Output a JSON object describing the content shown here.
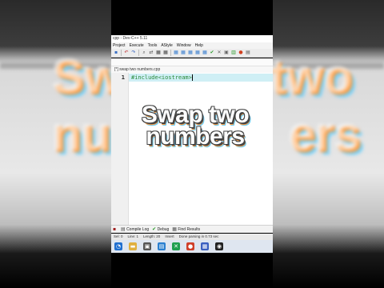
{
  "window": {
    "title": "cpp - Dev-C++ 5.11"
  },
  "menu": [
    "Project",
    "Execute",
    "Tools",
    "AStyle",
    "Window",
    "Help"
  ],
  "toolbar": {
    "icons": [
      "save-icon",
      "undo-icon",
      "redo-icon",
      "find-icon",
      "replace-icon",
      "compile-icon",
      "run-icon",
      "grid-icon",
      "grid-icon",
      "grid-icon",
      "grid-icon",
      "grid-icon",
      "check-icon",
      "close-icon",
      "debug-icon",
      "chart-icon",
      "profile-icon",
      "bug-icon"
    ]
  },
  "tab": {
    "label": "[*] swap two numbers.cpp"
  },
  "editor": {
    "line_number": "1",
    "code": "#include<iostream>"
  },
  "overlay": {
    "line1": "Swap two",
    "line2": "numbers"
  },
  "bottom_panel": {
    "compile_log": "Compile Log",
    "debug": "Debug",
    "find_results": "Find Results"
  },
  "status": {
    "sel": "Sel: 0",
    "line": "Line: 1",
    "length": "Length: 20",
    "mode": "Insert",
    "message": "Done parsing in 0.73 sec"
  },
  "side_text": {
    "left": "Sw",
    "left2": "nu",
    "right": "two",
    "right2": "ers"
  },
  "colors": {
    "accent_orange": "#ff9a3c",
    "accent_blue": "#6ad0ff",
    "code_green": "#2a8a3a",
    "line_highlight": "#cfeff5"
  }
}
